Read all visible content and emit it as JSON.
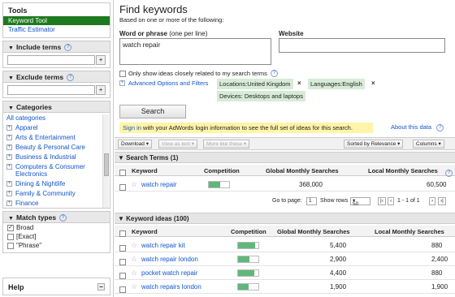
{
  "sidebar": {
    "tools_title": "Tools",
    "tools_items": [
      {
        "label": "Keyword Tool",
        "selected": true
      },
      {
        "label": "Traffic Estimator",
        "selected": false
      }
    ],
    "include_terms": "Include terms",
    "exclude_terms": "Exclude terms",
    "categories_title": "Categories",
    "all_categories": "All categories",
    "categories": [
      "Apparel",
      "Arts & Entertainment",
      "Beauty & Personal Care",
      "Business & Industrial",
      "Computers & Consumer Electronics",
      "Dining & Nightlife",
      "Family & Community",
      "Finance"
    ],
    "match_types_title": "Match types",
    "match_types": [
      {
        "label": "Broad",
        "checked": true
      },
      {
        "label": "[Exact]",
        "checked": false
      },
      {
        "label": "\"Phrase\"",
        "checked": false
      }
    ],
    "help_title": "Help",
    "plus_label": "+",
    "help_icon": "?",
    "minus": "−"
  },
  "main": {
    "title": "Find keywords",
    "subtitle": "Based on one or more of the following:",
    "word_label": "Word or phrase",
    "word_hint": "(one per line)",
    "website_label": "Website",
    "word_value": "watch repair",
    "only_show": "Only show ideas closely related to my search terms",
    "advanced": "Advanced Options and Filters",
    "chips": [
      "Locations:United Kingdom",
      "Languages:English",
      "Devices: Desktops and laptops"
    ],
    "chip_close": "×",
    "search_button": "Search",
    "signin_link": "Sign in",
    "signin_text": "with your AdWords login information to see the full set of ideas for this search.",
    "about_data": "About this data",
    "toolbar": {
      "download": "Download ▾",
      "view_as_text": "View as text ▾",
      "more_like": "More like these ▾",
      "sorted": "Sorted by Relevance ▾",
      "columns": "Columns ▾"
    },
    "columns": {
      "keyword": "Keyword",
      "competition": "Competition",
      "global": "Global Monthly Searches",
      "local": "Local Monthly Searches"
    },
    "search_terms_title": "Search Terms (1)",
    "search_terms": [
      {
        "keyword": "watch repair",
        "competition": 0.55,
        "global": "368,000",
        "local": "60,500"
      }
    ],
    "pager": {
      "go_to_page": "Go to page:",
      "page_value": "1",
      "show_rows": "Show rows",
      "rows_value": "50",
      "range": "1 - 1 of 1"
    },
    "ideas_title": "Keyword ideas (100)",
    "ideas": [
      {
        "keyword": "watch repair kit",
        "competition": 0.82,
        "global": "5,400",
        "local": "880"
      },
      {
        "keyword": "watch repair london",
        "competition": 0.55,
        "global": "2,900",
        "local": "2,400"
      },
      {
        "keyword": "pocket watch repair",
        "competition": 0.78,
        "global": "4,400",
        "local": "880"
      },
      {
        "keyword": "watch repairs london",
        "competition": 0.5,
        "global": "1,900",
        "local": "1,900"
      }
    ]
  }
}
